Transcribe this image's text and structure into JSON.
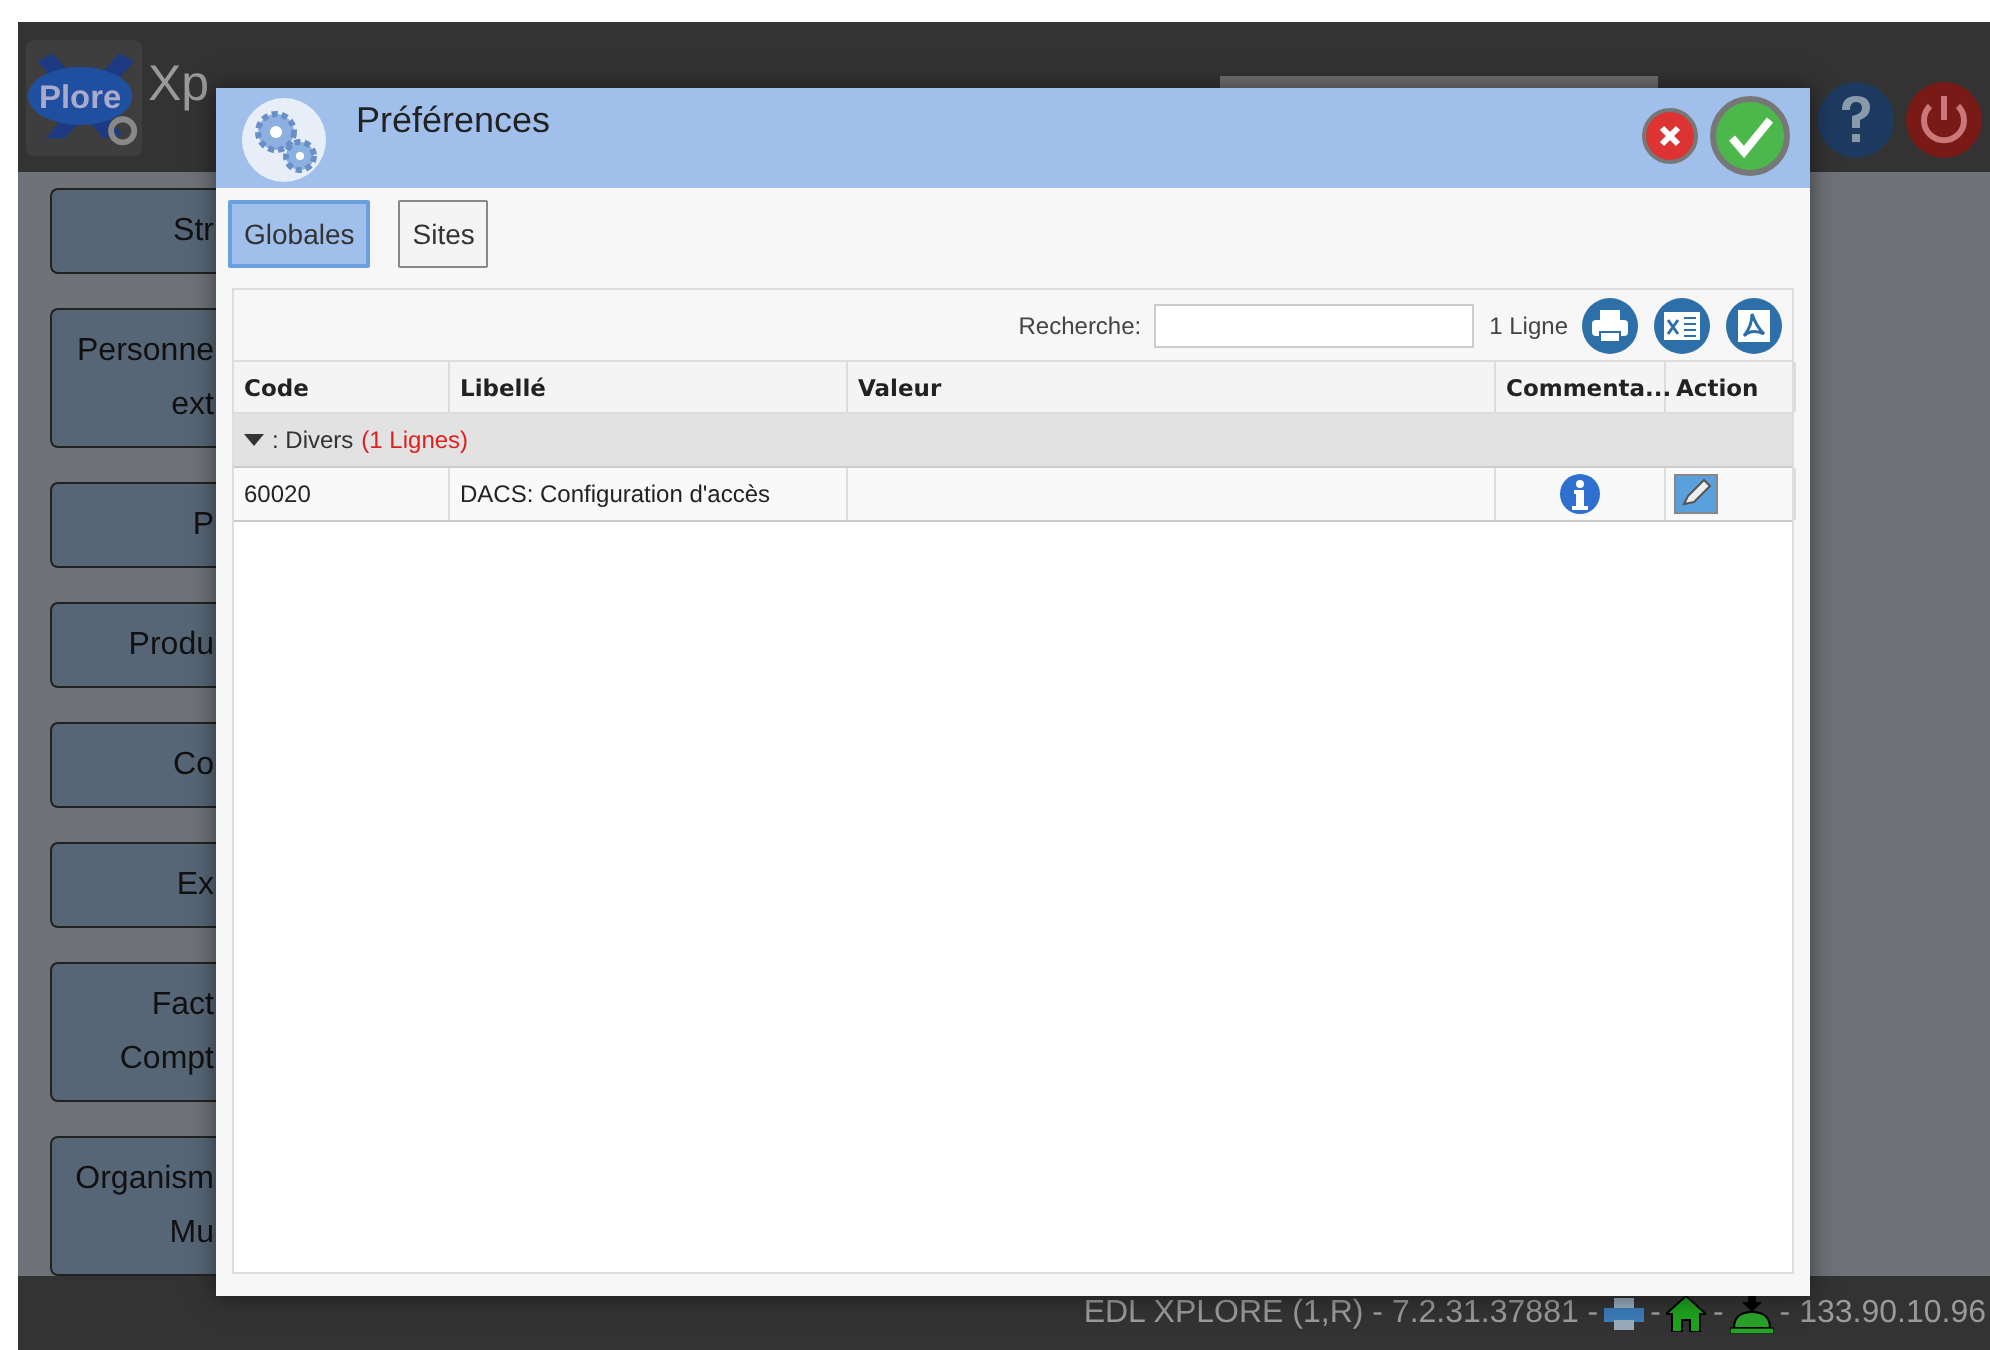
{
  "app": {
    "logo": "Plore",
    "title": "Xp",
    "sidebar": [
      {
        "lines": [
          "Str"
        ]
      },
      {
        "lines": [
          "Personne",
          "ext"
        ]
      },
      {
        "lines": [
          "P"
        ]
      },
      {
        "lines": [
          "Produ"
        ]
      },
      {
        "lines": [
          "Co"
        ]
      },
      {
        "lines": [
          "Ex"
        ]
      },
      {
        "lines": [
          "Fact",
          "Compt"
        ]
      },
      {
        "lines": [
          "Organism",
          "Mu"
        ]
      }
    ]
  },
  "dialog": {
    "title": "Préférences",
    "tabs": [
      {
        "label": "Globales",
        "selected": true
      },
      {
        "label": "Sites",
        "selected": false
      }
    ],
    "search_label": "Recherche:",
    "count": "1 Ligne",
    "columns": [
      "Code",
      "Libellé",
      "Valeur",
      "Commenta...",
      "Action"
    ],
    "groups": [
      {
        "name": ": Divers",
        "count": "(1 Lignes)",
        "expanded": true,
        "rows": [
          {
            "code": "60020",
            "label": "DACS: Configuration d'accès"
          }
        ]
      }
    ]
  },
  "status_bar": [
    {
      "kind": "text",
      "text": "EDL XPLORE (1,R) - 7.2.31.37881 -"
    },
    {
      "kind": "printer"
    },
    {
      "kind": "text",
      "text": "-"
    },
    {
      "kind": "home"
    },
    {
      "kind": "text",
      "text": "-"
    },
    {
      "kind": "bell"
    },
    {
      "kind": "text",
      "text": "- 133.90.10.96"
    }
  ]
}
